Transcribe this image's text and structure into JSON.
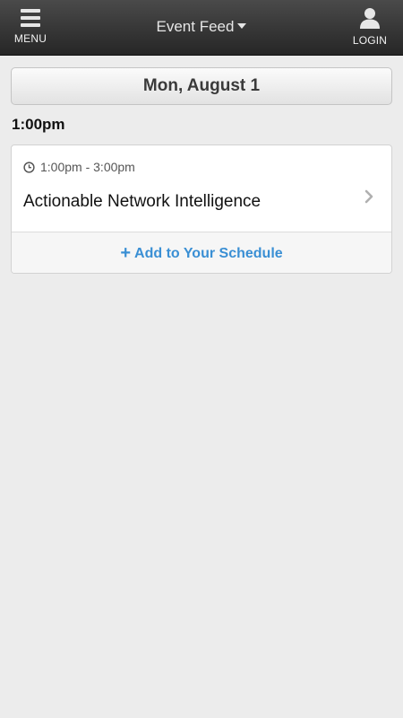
{
  "header": {
    "menu_label": "MENU",
    "title": "Event Feed",
    "login_label": "LOGIN"
  },
  "icons": {
    "menu": "hamburger-icon",
    "dropdown": "caret-down-icon",
    "login": "user-icon",
    "time": "clock-icon",
    "open": "chevron-right-icon",
    "add": "plus-icon"
  },
  "date_bar": {
    "label": "Mon, August 1"
  },
  "schedule": {
    "time_heading": "1:00pm",
    "sessions": [
      {
        "time_range": "1:00pm - 3:00pm",
        "title": "Actionable Network Intelligence",
        "action_label": "Add to Your Schedule"
      }
    ]
  },
  "colors": {
    "accent": "#3a8fd4",
    "header_bg": "#333333",
    "page_bg": "#ececec"
  }
}
